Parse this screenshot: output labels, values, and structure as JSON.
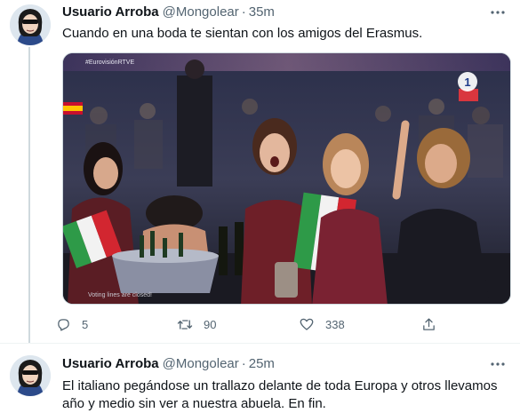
{
  "tweets": [
    {
      "author_name": "Usuario Arroba",
      "handle": "@Mongolear",
      "separator": "·",
      "time": "35m",
      "text": "Cuando en una boda te sientan con los amigos del Erasmus.",
      "media": {
        "overlay_hashtag": "#EurovisiónRTVE",
        "channel_logo": "1",
        "caption": "Voting lines are closed!"
      },
      "replies": "5",
      "retweets": "90",
      "likes": "338"
    },
    {
      "author_name": "Usuario Arroba",
      "handle": "@Mongolear",
      "separator": "·",
      "time": "25m",
      "text": "El italiano pegándose un trallazo delante de toda Europa y otros llevamos año y medio sin ver a nuestra abuela. En fin."
    }
  ],
  "colors": {
    "text": "#0f1419",
    "secondary": "#536471",
    "divider": "#eff3f4",
    "thread_line": "#cfd9de"
  },
  "icons": [
    "avatar-icon",
    "more-icon",
    "reply-icon",
    "retweet-icon",
    "like-icon",
    "share-icon"
  ]
}
